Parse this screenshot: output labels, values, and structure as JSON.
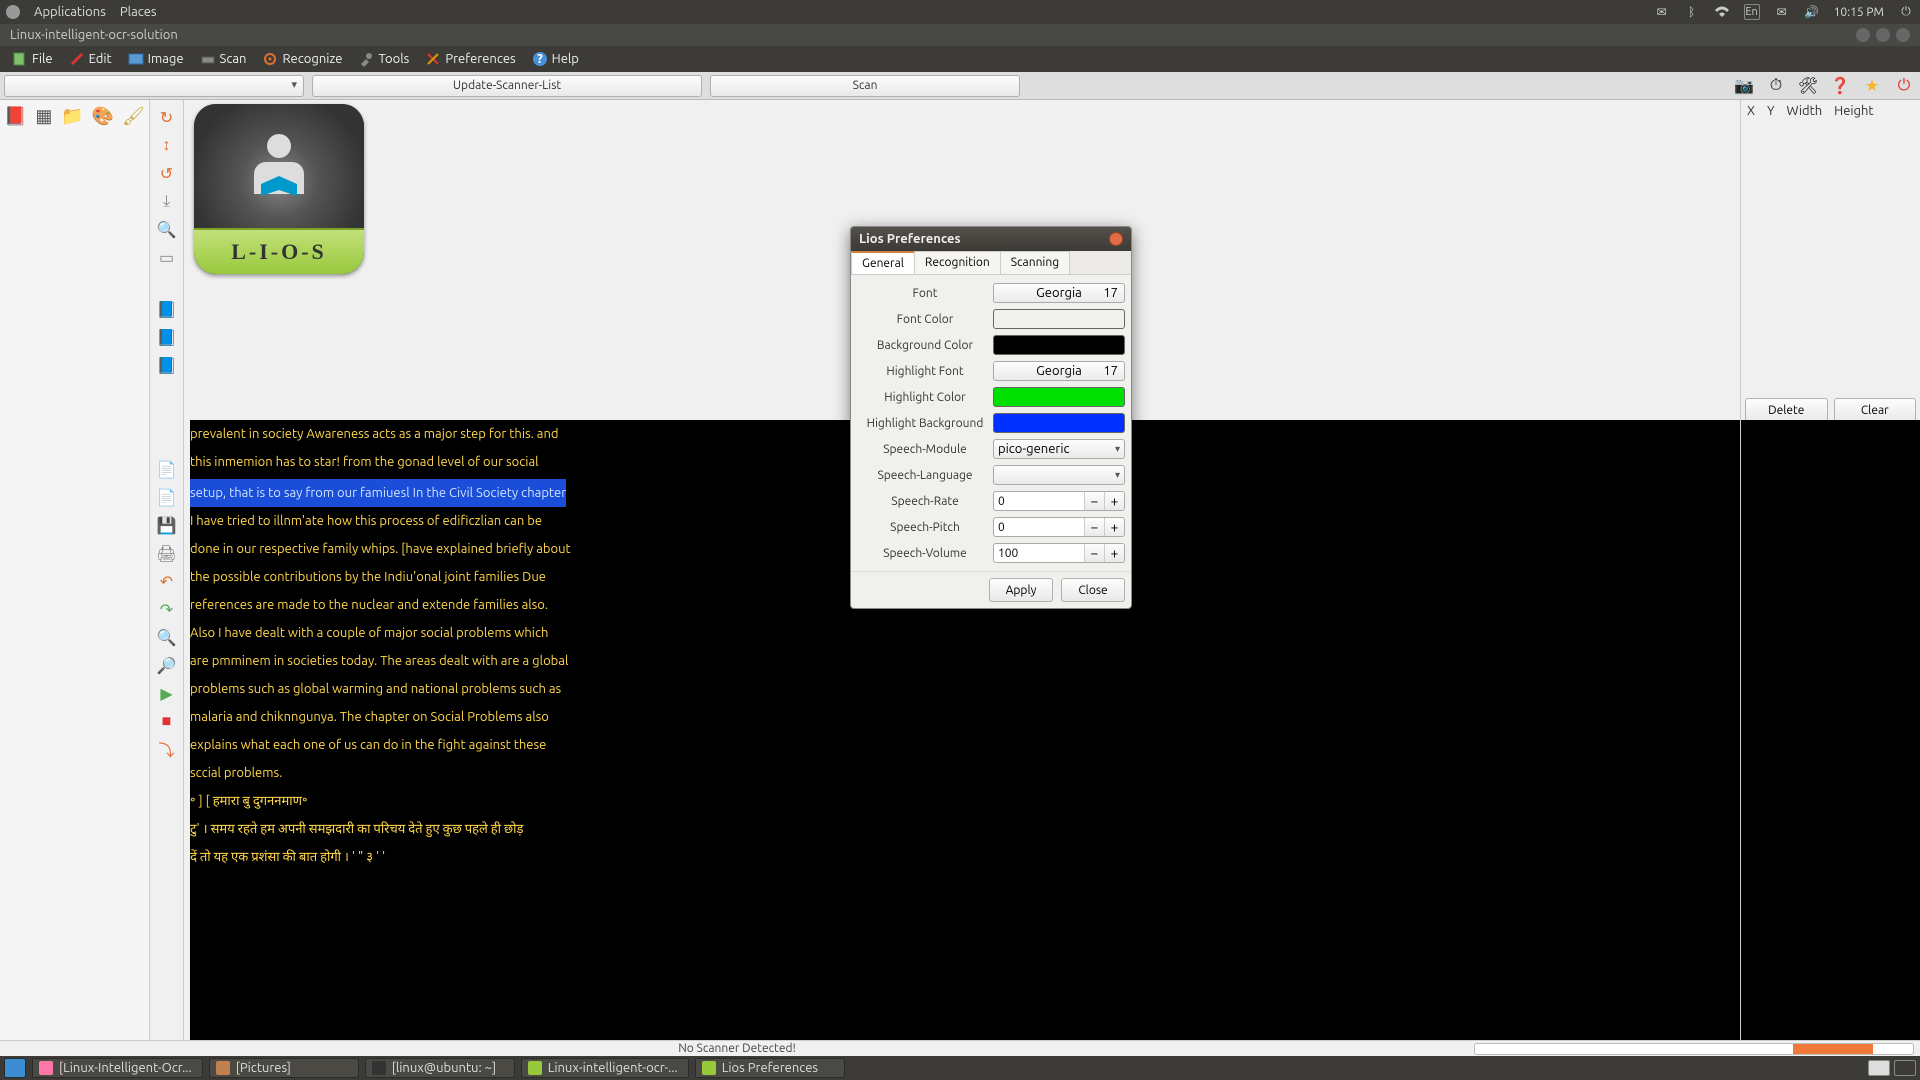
{
  "gnome": {
    "applications": "Applications",
    "places": "Places",
    "lang": "En",
    "time": "10:15 PM"
  },
  "window": {
    "title": "Linux-intelligent-ocr-solution"
  },
  "menus": {
    "file": "File",
    "edit": "Edit",
    "image": "Image",
    "scan": "Scan",
    "recognize": "Recognize",
    "tools": "Tools",
    "preferences": "Preferences",
    "help": "Help"
  },
  "toolbar": {
    "update_scanner": "Update-Scanner-List",
    "scan": "Scan"
  },
  "logo": {
    "text": "L-I-O-S"
  },
  "xywh": {
    "x": "X",
    "y": "Y",
    "w": "Width",
    "h": "Height",
    "delete": "Delete",
    "clear": "Clear"
  },
  "text": {
    "l1": "prevalent in society Awareness acts as a major step for this. and",
    "l2": "this inmemion has to star! from the gonad level of our social",
    "l3": "setup, that is to say from our famiuesl In the Civil Society chapter",
    "l4": "I have tried to illnm'ate how this process of edificzlian can be",
    "l5": "done in our respective family whips. [have explained briefly about",
    "l6": "the possible contributions by the Indiu'onal joint families Due",
    "l7": "references are made to the nuclear and extende families also.",
    "l8": "Also I have dealt with a couple of major social problems which",
    "l9": "are pmminem in societies today. The areas dealt with are a global",
    "l10": "problems such as global warming and national problems such as",
    "l11": "malaria and chiknngunya. The chapter on Social Problems also",
    "l12": "explains what each one of us can do in the fight against these",
    "l13": "sccial problems.",
    "l14": "",
    "l15": "॰ ] [ हमारा बु दुगननमाण॰",
    "l16": "",
    "l17": "टु' । समय रहते हम अपनी समझदारी का परिचय देते हुए कुछ पहले ही छोड़",
    "l18": "दें तो यह एक प्रशंसा की बात होगी । ' \" ३ ' '"
  },
  "prefs": {
    "title": "Lios Preferences",
    "tabs": {
      "general": "General",
      "recognition": "Recognition",
      "scanning": "Scanning"
    },
    "labels": {
      "font": "Font",
      "font_color": "Font Color",
      "bg_color": "Background Color",
      "hl_font": "Highlight Font",
      "hl_color": "Highlight Color",
      "hl_bg": "Highlight Background",
      "sp_module": "Speech-Module",
      "sp_lang": "Speech-Language",
      "sp_rate": "Speech-Rate",
      "sp_pitch": "Speech-Pitch",
      "sp_vol": "Speech-Volume"
    },
    "values": {
      "font_name": "Georgia",
      "font_size": "17",
      "hl_font_name": "Georgia",
      "hl_font_size": "17",
      "sp_module": "pico-generic",
      "sp_lang": "",
      "sp_rate": "0",
      "sp_pitch": "0",
      "sp_vol": "100"
    },
    "colors": {
      "font": "#ffe600",
      "bg": "#000000",
      "hl": "#00e000",
      "hlbg": "#0030ff"
    },
    "buttons": {
      "apply": "Apply",
      "close": "Close"
    }
  },
  "status": {
    "msg": "No Scanner Detected!"
  },
  "taskbar": {
    "t1": "[Linux-Intelligent-Ocr...",
    "t2": "[Pictures]",
    "t3": "[linux@ubuntu: ~]",
    "t4": "Linux-intelligent-ocr-...",
    "t5": "Lios Preferences"
  }
}
